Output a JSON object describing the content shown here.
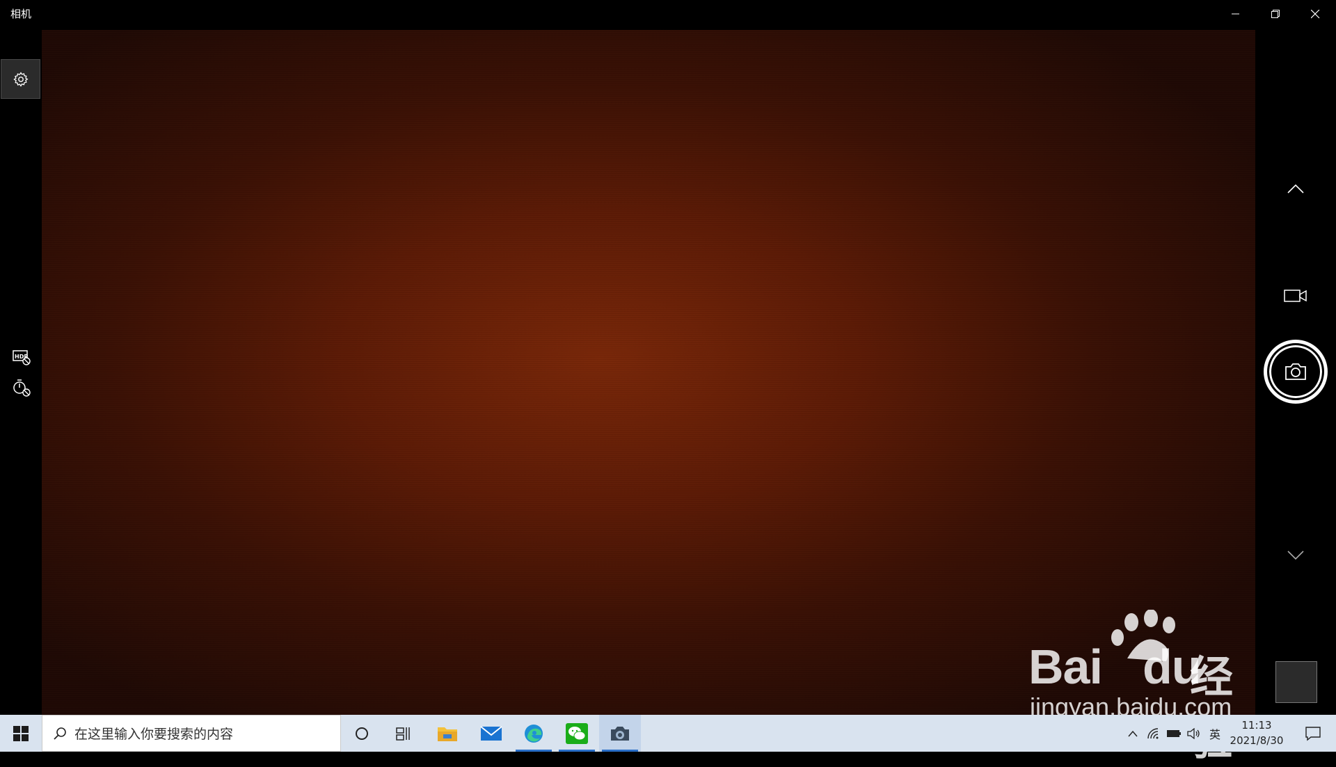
{
  "window": {
    "title": "相机",
    "controls": [
      "minimize-icon",
      "restore-icon",
      "close-icon"
    ]
  },
  "left_rail": {
    "buttons": [
      "gear-icon",
      "hdr-off-icon",
      "timer-off-icon"
    ]
  },
  "right_rail": {
    "buttons": [
      "chevron-up-icon",
      "video-camera-icon",
      "camera-shutter-icon",
      "chevron-down-icon",
      "last-capture-thumbnail"
    ]
  },
  "watermark": {
    "brand": "Bai",
    "brand2": "du",
    "cn": "经验",
    "url": "jingyan.baidu.com"
  },
  "taskbar": {
    "search_placeholder": "在这里输入你要搜索的内容",
    "apps": [
      "cortana-icon",
      "task-view-icon",
      "file-explorer-icon",
      "mail-icon",
      "edge-icon",
      "wechat-icon",
      "camera-app-icon"
    ],
    "active_app": "camera-app-icon",
    "ime": "英",
    "time": "11:13",
    "date": "2021/8/30",
    "colors": {
      "taskbar": "#d9e3ef",
      "accent": "#2a6fc9"
    }
  }
}
